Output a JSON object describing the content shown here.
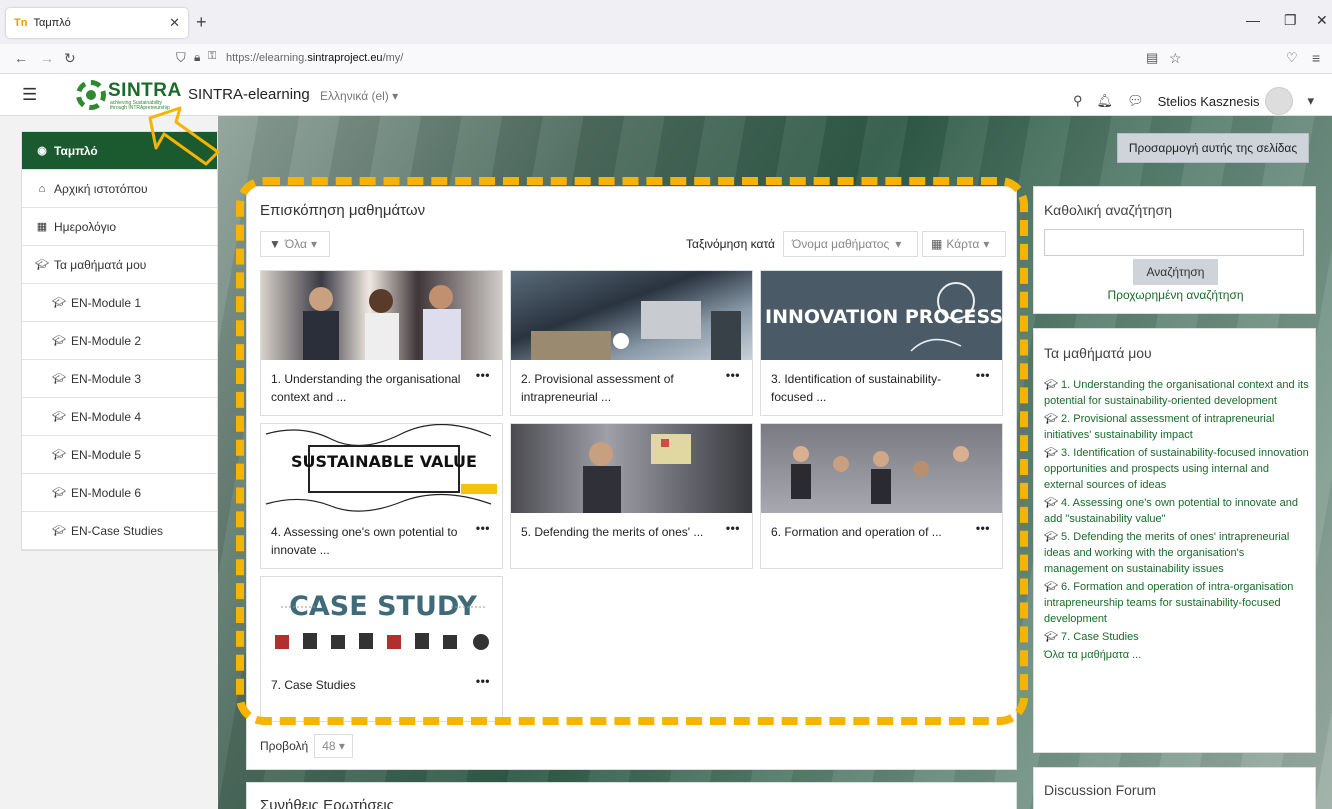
{
  "browser": {
    "tab_title": "Ταμπλό",
    "tab_favicon": "Tn",
    "url_prefix": "https://elearning.",
    "url_domain": "sintraproject.eu",
    "url_suffix": "/my/"
  },
  "header": {
    "logo_word": "SINTRA",
    "logo_tagline": "achieving Sustainability through INTRApreneurship",
    "site_name": "SINTRA-elearning",
    "language": "Ελληνικά (el) ▾",
    "user_name": "Stelios Kasznesis"
  },
  "sidebar": {
    "items": [
      {
        "label": "Ταμπλό",
        "icon": "dashboard-icon"
      },
      {
        "label": "Αρχική ιστοτόπου",
        "icon": "home-icon"
      },
      {
        "label": "Ημερολόγιο",
        "icon": "calendar-icon"
      },
      {
        "label": "Τα μαθήματά μου",
        "icon": "graduation-cap-icon"
      },
      {
        "label": "EN-Module 1",
        "icon": "graduation-cap-icon"
      },
      {
        "label": "EN-Module 2",
        "icon": "graduation-cap-icon"
      },
      {
        "label": "EN-Module 3",
        "icon": "graduation-cap-icon"
      },
      {
        "label": "EN-Module 4",
        "icon": "graduation-cap-icon"
      },
      {
        "label": "EN-Module 5",
        "icon": "graduation-cap-icon"
      },
      {
        "label": "EN-Module 6",
        "icon": "graduation-cap-icon"
      },
      {
        "label": "EN-Case Studies",
        "icon": "graduation-cap-icon"
      }
    ]
  },
  "customize_button": "Προσαρμογή αυτής της σελίδας",
  "overview": {
    "title": "Επισκόπηση μαθημάτων",
    "filter_label": "Όλα",
    "sort_by_label": "Ταξινόμηση κατά",
    "sort_value": "Όνομα μαθήματος",
    "view_value": "Κάρτα",
    "courses": [
      {
        "title": "1. Understanding the organisational context and ...",
        "image_text": ""
      },
      {
        "title": "2. Provisional assessment of intrapreneurial ...",
        "image_text": ""
      },
      {
        "title": "3. Identification of sustainability-focused ...",
        "image_text": "INNOVATION PROCESS"
      },
      {
        "title": "4. Assessing one's own potential to innovate ...",
        "image_text": "SUSTAINABLE VALUE"
      },
      {
        "title": "5. Defending the merits of ones' ...",
        "image_text": ""
      },
      {
        "title": "6. Formation and operation of ...",
        "image_text": ""
      },
      {
        "title": "7. Case Studies",
        "image_text": "CASE STUDY"
      }
    ],
    "per_page_label": "Προβολή",
    "per_page_value": "48"
  },
  "global_search": {
    "title": "Καθολική αναζήτηση",
    "button": "Αναζήτηση",
    "advanced": "Προχωρημένη αναζήτηση"
  },
  "my_courses": {
    "title": "Τα μαθήματά μου",
    "items": [
      "1. Understanding the organisational context and its potential for sustainability-oriented development",
      "2. Provisional assessment of intrapreneurial initiatives' sustainability impact",
      "3. Identification of sustainability-focused innovation opportunities and prospects using internal and external sources of ideas",
      "4. Assessing one's own potential to innovate and add \"sustainability value\"",
      "5. Defending the merits of ones' intrapreneurial ideas and working with the organisation's management on sustainability issues",
      "6. Formation and operation of intra-organisation intrapreneurship teams for sustainability-focused development",
      "7. Case Studies"
    ],
    "all_link": "Όλα τα μαθήματα ..."
  },
  "discussion_forum": {
    "title": "Discussion Forum"
  },
  "faq": {
    "title": "Συνήθεις Ερωτήσεις"
  },
  "colors": {
    "brand_green": "#1a5a2e",
    "link_green": "#1a6b2a",
    "annotation": "#f5b400"
  }
}
